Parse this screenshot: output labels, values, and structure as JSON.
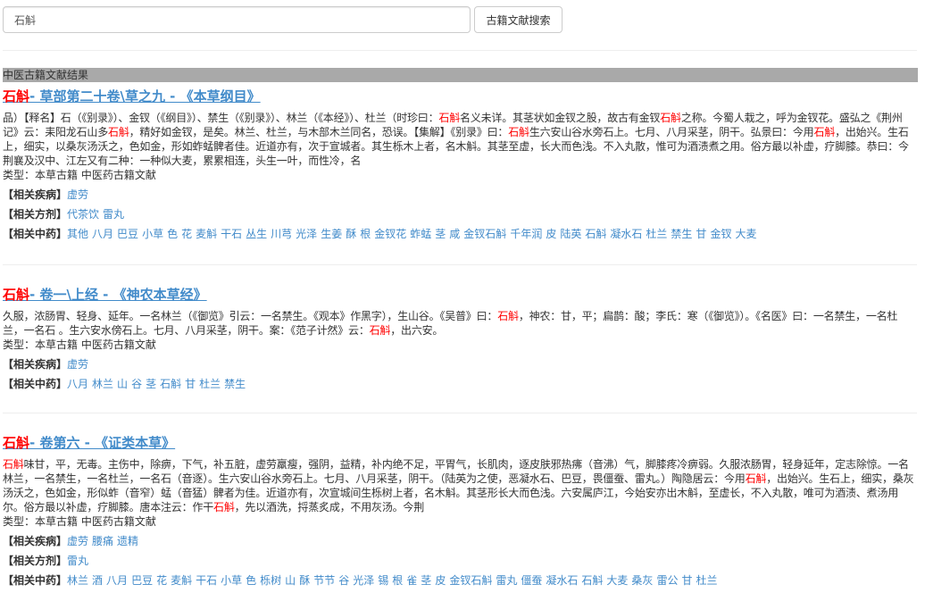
{
  "search": {
    "value": "石斛",
    "button": "古籍文献搜索"
  },
  "section_title": "中医古籍文献结果",
  "entries": [
    {
      "keyword": "石斛",
      "title": "- 草部第二十卷\\草之九 - 《本草纲目》",
      "paragraph": [
        {
          "t": "品）【释名】石（《别录》）、金钗（《纲目》）、禁生（《别录》）、林兰（《本经》）、杜兰（时珍曰："
        },
        {
          "t": "石斛",
          "hl": true
        },
        {
          "t": "名义未详。其茎状如金钗之股，故古有金钗"
        },
        {
          "t": "石斛",
          "hl": true
        },
        {
          "t": "之称。今蜀人栽之，呼为金钗花。盛弘之《荆州记》云：耒阳龙石山多"
        },
        {
          "t": "石斛",
          "hl": true
        },
        {
          "t": "，精好如金钗，是矣。林兰、杜兰，与木部木兰同名，恐误。【集解】《别录》曰："
        },
        {
          "t": "石斛",
          "hl": true
        },
        {
          "t": "生六安山谷水旁石上。七月、八月采茎，阴干。弘景曰：今用"
        },
        {
          "t": "石斛",
          "hl": true
        },
        {
          "t": "，出始兴。生石上，细实，以桑灰汤沃之，色如金，形如蚱蜢髀者佳。近道亦有，次于宣城者。其生栎木上者，名木斛。其茎至虚，长大而色浅。不入丸散，惟可为酒渍煮之用。俗方最以补虚，疗脚膝。恭曰：今荆襄及汉中、江左又有二种：一种似大麦，累累相连，头生一叶，而性冷，名"
        }
      ],
      "type": "类型：本草古籍 中医药古籍文献",
      "related": [
        {
          "label": "【相关疾病】",
          "items": [
            "虚劳"
          ]
        },
        {
          "label": "【相关方剂】",
          "items": [
            "代茶饮",
            "雷丸"
          ]
        },
        {
          "label": "【相关中药】",
          "items": [
            "其他",
            "八月",
            "巴豆",
            "小草",
            "色",
            "花",
            "麦斛",
            "干石",
            "丛生",
            "川芎",
            "光泽",
            "生姜",
            "酥",
            "根",
            "金钗花",
            "蚱蜢",
            "茎",
            "咸",
            "金钗石斛",
            "千年润",
            "皮",
            "陆英",
            "石斛",
            "凝水石",
            "杜兰",
            "禁生",
            "甘",
            "金钗",
            "大麦"
          ]
        }
      ]
    },
    {
      "keyword": "石斛",
      "title": "- 卷一\\上经 - 《神农本草经》",
      "paragraph": [
        {
          "t": "久服，浓肠胃、轻身、延年。一名林兰（《御览》引云：一名禁生。《观本》作黑字），生山谷。《吴普》曰："
        },
        {
          "t": "石斛",
          "hl": true
        },
        {
          "t": "，神农：甘，平；扁鹊：酸；李氏：寒（《御览》）。《名医》曰：一名禁生，一名杜兰，一名石 。生六安水傍石上。七月、八月采茎，阴干。案：《范子计然》云："
        },
        {
          "t": "石斛",
          "hl": true
        },
        {
          "t": "，出六安。"
        }
      ],
      "type": "类型：本草古籍 中医药古籍文献",
      "related": [
        {
          "label": "【相关疾病】",
          "items": [
            "虚劳"
          ]
        },
        {
          "label": "【相关中药】",
          "items": [
            "八月",
            "林兰",
            "山",
            "谷",
            "茎",
            "石斛",
            "甘",
            "杜兰",
            "禁生"
          ]
        }
      ]
    },
    {
      "keyword": "石斛",
      "title": "- 卷第六 - 《证类本草》",
      "paragraph": [
        {
          "t": "石斛",
          "hl": true
        },
        {
          "t": "味甘，平，无毒。主伤中，除痹，下气，补五脏，虚劳羸瘦，强阴，益精，补内绝不足，平胃气，长肌肉，逐皮肤邪热疿（音沸）气，脚膝疼冷痹弱。久服浓肠胃，轻身延年，定志除惊。一名林兰，一名禁生，一名杜兰，一名石（音逐）。生六安山谷水旁石上。七月、八月采茎，阴干。（陆英为之使，恶凝水石、巴豆，畏僵蚕、雷丸。）陶隐居云：今用"
        },
        {
          "t": "石斛",
          "hl": true
        },
        {
          "t": "，出始兴。生石上，细实，桑灰汤沃之，色如金，形似蚱（音窄）蜢（音猛）髀者为佳。近道亦有，次宣城间生栎树上者，名木斛。其茎形长大而色浅。六安属庐江，今始安亦出木斛，至虚长，不入丸散，唯可为酒渍、煮汤用尔。俗方最以补虚，疗脚膝。唐本注云：作干"
        },
        {
          "t": "石斛",
          "hl": true
        },
        {
          "t": "，先以酒洗，捋蒸炙成，不用灰汤。今荆"
        }
      ],
      "type": "类型：本草古籍 中医药古籍文献",
      "related": [
        {
          "label": "【相关疾病】",
          "items": [
            "虚劳",
            "腰痛",
            "遗精"
          ]
        },
        {
          "label": "【相关方剂】",
          "items": [
            "雷丸"
          ]
        },
        {
          "label": "【相关中药】",
          "items": [
            "林兰",
            "酒",
            "八月",
            "巴豆",
            "花",
            "麦斛",
            "干石",
            "小草",
            "色",
            "栎树",
            "山",
            "酥",
            "节节",
            "谷",
            "光泽",
            "锡",
            "根",
            "雀",
            "茎",
            "皮",
            "金钗石斛",
            "雷丸",
            "僵蚕",
            "凝水石",
            "石斛",
            "大麦",
            "桑灰",
            "雷公",
            "甘",
            "杜兰"
          ]
        }
      ]
    }
  ]
}
